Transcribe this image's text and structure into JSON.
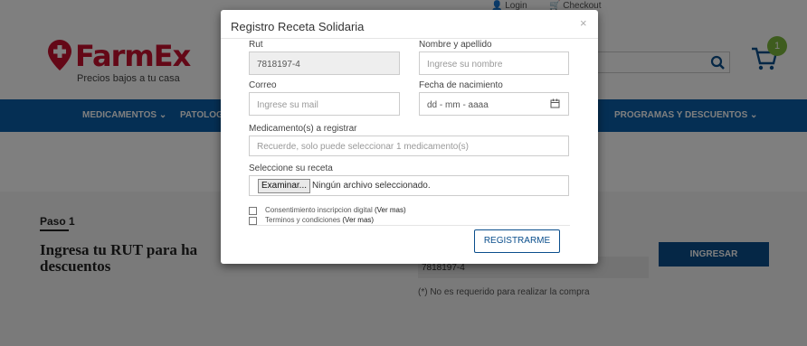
{
  "topbar": {
    "login": "Login",
    "checkout": "Checkout"
  },
  "logo": {
    "name": "FarmEx",
    "tagline": "Precios bajos a tu casa"
  },
  "cart": {
    "count": "1"
  },
  "nav": {
    "items": [
      "MEDICAMENTOS ⌄",
      "PATOLOGI",
      "PROGRAMAS Y DESCUENTOS ⌄"
    ]
  },
  "page": {
    "paso": "Paso 1",
    "heading": "Ingresa tu RUT para ha descuentos",
    "rut_value": "7818197-4",
    "note": "(*) No es requerido para realizar la compra",
    "ingresar": "INGRESAR"
  },
  "modal": {
    "title": "Registro Receta Solidaria",
    "close": "×",
    "rut_label": "Rut",
    "rut_value": "7818197-4",
    "name_label": "Nombre y apellido",
    "name_placeholder": "Ingrese su nombre",
    "mail_label": "Correo",
    "mail_placeholder": "Ingrese su mail",
    "birth_label": "Fecha de nacimiento",
    "birth_placeholder": "dd - mm - aaaa",
    "med_label": "Medicamento(s) a registrar",
    "med_placeholder": "Recuerde, solo puede seleccionar 1 medicamento(s)",
    "receta_label": "Seleccione su receta",
    "file_button": "Examinar...",
    "file_status": "Ningún archivo seleccionado.",
    "consent_label": "Consentimiento inscripcion digital",
    "terms_label": "Terminos y condiciones",
    "ver_mas": "(Ver mas)",
    "register": "REGISTRARME"
  },
  "colors": {
    "brand_red": "#c8102e",
    "nav_blue": "#0b5ea8",
    "badge_green": "#7db93d"
  }
}
